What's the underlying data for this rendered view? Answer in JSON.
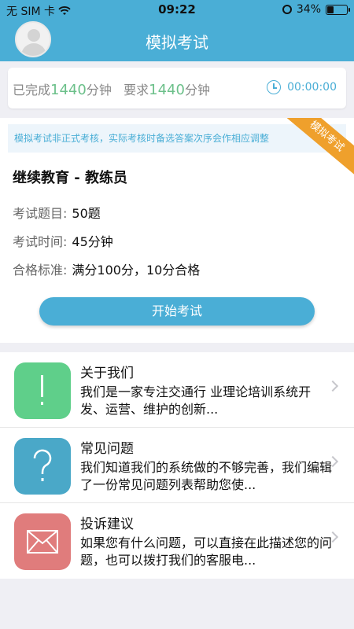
{
  "status_bar": {
    "carrier": "无 SIM 卡",
    "time": "09:22",
    "battery": "34%",
    "battery_level": 0.34
  },
  "nav": {
    "title": "模拟考试",
    "avatar": "avatar"
  },
  "progress": {
    "completed_prefix": "已完成",
    "completed_value": "1440",
    "completed_unit": "分钟",
    "required_prefix": "要求",
    "required_value": "1440",
    "required_unit": "分钟",
    "timer": "00:00:00"
  },
  "exam": {
    "notice": "模拟考试非正式考核，实际考核时备选答案次序会作相应调整",
    "ribbon": "模拟考试",
    "title": "继续教育 - 教练员",
    "rows": [
      {
        "label": "考试题目:",
        "value": "50题"
      },
      {
        "label": "考试时间:",
        "value": "45分钟"
      },
      {
        "label": "合格标准:",
        "value": "满分100分，10分合格"
      }
    ],
    "start_button": "开始考试"
  },
  "list": [
    {
      "icon": "info-exclamation-icon",
      "color": "#5fcf8a",
      "title": "关于我们",
      "desc": "我们是一家专注交通行 业理论培训系统开发、运营、维护的创新..."
    },
    {
      "icon": "question-mark-icon",
      "color": "#4aa8c8",
      "title": "常见问题",
      "desc": "我们知道我们的系统做的不够完善，我们编辑 了一份常见问题列表帮助您使..."
    },
    {
      "icon": "envelope-icon",
      "color": "#e07c7c",
      "title": "投诉建议",
      "desc": "如果您有什么问题，可以直接在此描述您的问 题，也可以拨打我们的客服电..."
    }
  ],
  "colors": {
    "primary": "#4aaed6",
    "accent_green": "#6cc08a",
    "ribbon_orange": "#efa02c"
  }
}
